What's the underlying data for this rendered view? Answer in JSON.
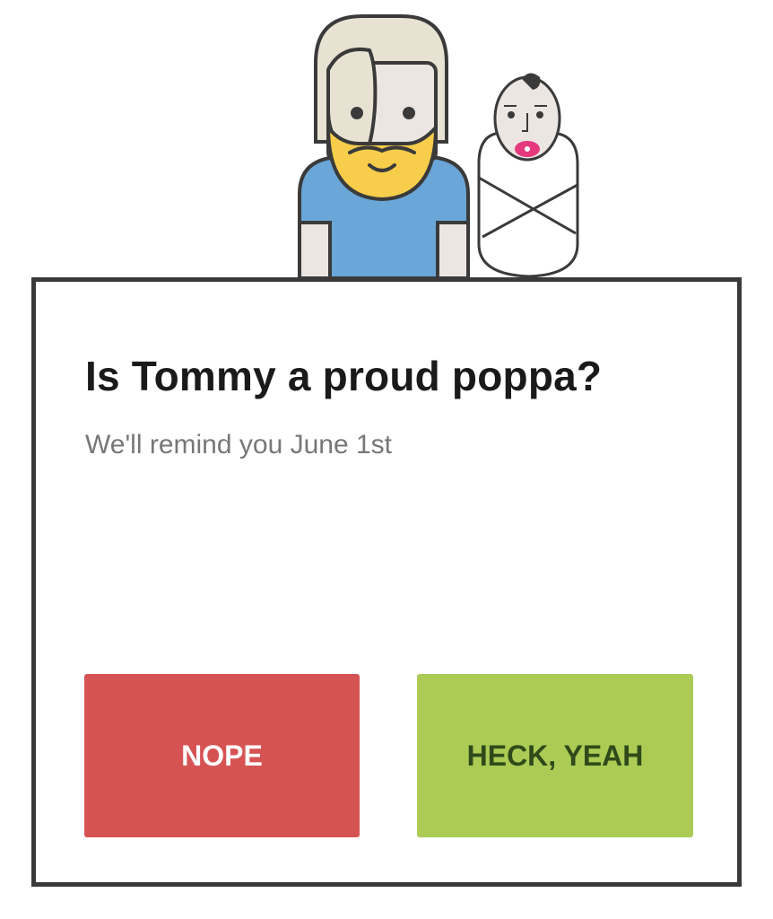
{
  "illustration": {
    "dad_hair_color": "#e8e2d3",
    "dad_beard_color": "#f7cd4b",
    "dad_shirt_color": "#6aa6d8",
    "skin_color": "#ece6e3",
    "pacifier_color": "#e5397e",
    "outline_color": "#3a3a3a"
  },
  "dialog": {
    "title": "Is Tommy a proud poppa?",
    "subtitle": "We'll remind you June 1st",
    "border_color": "#3a3a3a"
  },
  "buttons": {
    "nope_label": "NOPE",
    "nope_color": "#d65353",
    "yeah_label": "HECK, YEAH",
    "yeah_color": "#abcb55"
  }
}
